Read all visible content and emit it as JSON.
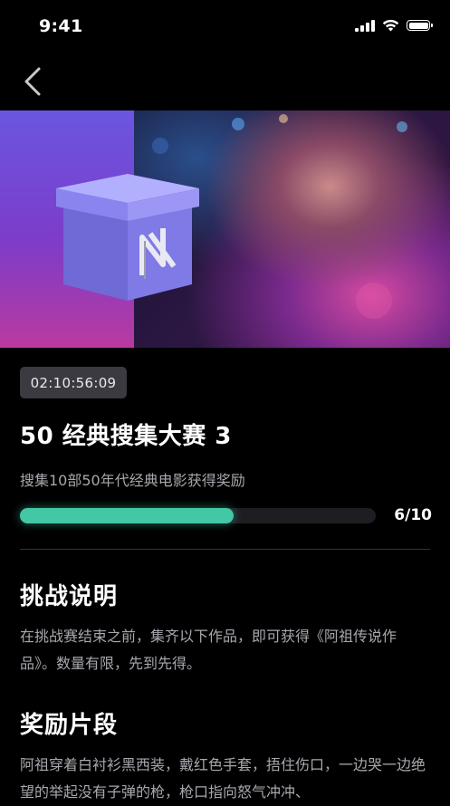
{
  "status_bar": {
    "time": "9:41"
  },
  "timer": "02:10:56:09",
  "title": "50 经典搜集大赛 3",
  "subtitle": "搜集10部50年代经典电影获得奖励",
  "progress": {
    "current": 6,
    "total": 10,
    "label": "6/10",
    "fraction": 0.6
  },
  "challenge": {
    "heading": "挑战说明",
    "body": "在挑战赛结束之前，集齐以下作品，即可获得《阿祖传说作品》。数量有限，先到先得。"
  },
  "reward": {
    "heading": "奖励片段",
    "body": "阿祖穿着白衬衫黑西装，戴红色手套，捂住伤口，一边哭一边绝望的举起没有子弹的枪，枪口指向怒气冲冲、"
  },
  "icons": {
    "back": "chevron-left-icon",
    "signal": "cellular-signal-icon",
    "wifi": "wifi-icon",
    "battery": "battery-icon",
    "box": "gift-box-icon"
  },
  "colors": {
    "accent": "#43c7a5",
    "background": "#000000",
    "badge": "#3a3a40"
  }
}
